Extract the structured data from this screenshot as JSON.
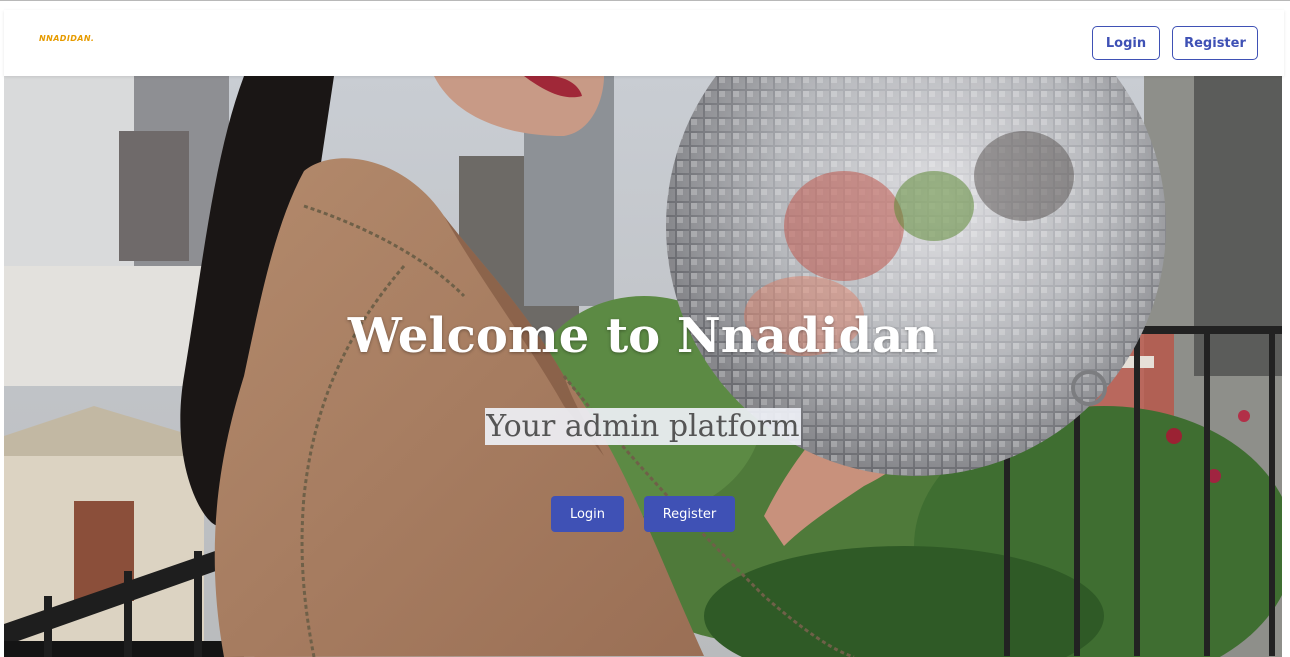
{
  "brand": {
    "name": "NNADIDAN.",
    "color": "#e69b00"
  },
  "navbar": {
    "login_label": "Login",
    "register_label": "Register"
  },
  "hero": {
    "title": "Welcome to Nnadidan",
    "subtitle": "Your admin platform",
    "login_label": "Login",
    "register_label": "Register",
    "image_description_icon": "hero-photo"
  },
  "colors": {
    "primary": "#3f51b5",
    "navbar_background": "#ffffff",
    "hero_title": "#ffffff",
    "subtitle_text": "#555555"
  }
}
